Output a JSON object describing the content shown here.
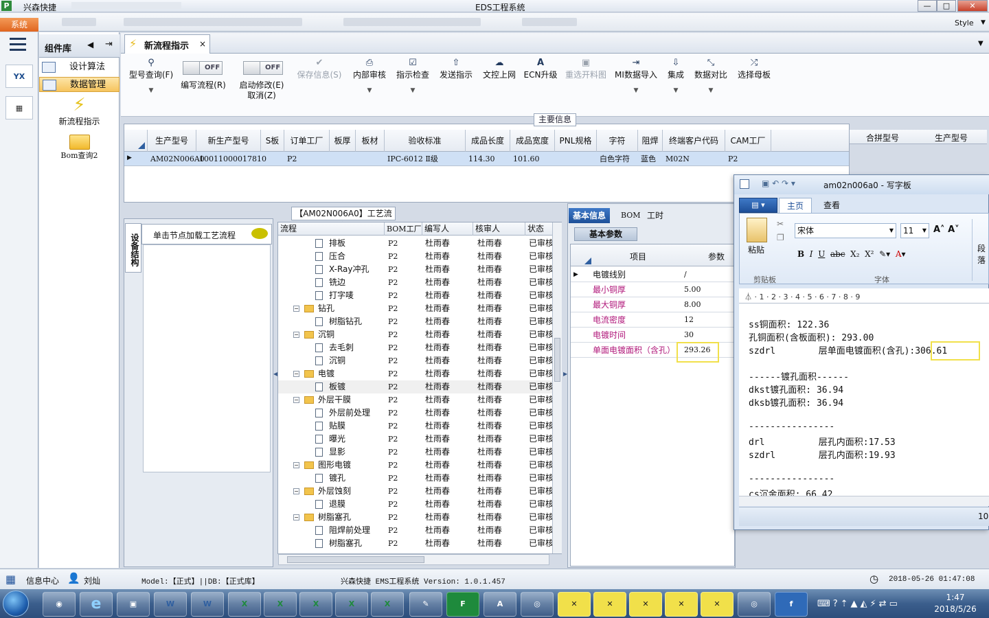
{
  "app": {
    "name": "兴森快捷",
    "window_title": "EDS工程系统",
    "system_menu": "系统",
    "style_label": "Style"
  },
  "left_nav": {
    "menu_icon": "hamburger-icon",
    "icon1": "YX",
    "icon2": "calc"
  },
  "component_panel": {
    "title": "组件库",
    "items": [
      {
        "label": "设计算法"
      },
      {
        "label": "数据管理"
      }
    ],
    "big_items": [
      {
        "label": "新流程指示",
        "icon": "lightning-icon"
      },
      {
        "label": "Bom查询2",
        "icon": "folder-icon"
      }
    ]
  },
  "tab": {
    "label": "新流程指示",
    "close": "×"
  },
  "toolbar": {
    "model_query": "型号查询(F)",
    "edit_flow": "编写流程(R)",
    "start_edit_line1": "启动修改(E)",
    "start_edit_line2": "取消(Z)",
    "toggle_off": "OFF",
    "save_info": "保存信息(S)",
    "internal_review": "内部审核",
    "check_instruction": "指示检查",
    "send_instruction": "发送指示",
    "doc_upload": "文控上网",
    "ecn_upgrade": "ECN升级",
    "reselect": "重选开料图",
    "mi_import": "MI数据导入",
    "integrate": "集成",
    "compare": "数据对比",
    "select_mother": "选择母板"
  },
  "main_info": {
    "group_label": "主要信息",
    "columns": [
      "生产型号",
      "新生产型号",
      "S板",
      "订单工厂",
      "板厚",
      "板材",
      "验收标准",
      "成品长度",
      "成品宽度",
      "PNL规格",
      "字符",
      "阻焊",
      "终端客户代码",
      "CAM工厂"
    ],
    "row": [
      "AM02N006A0",
      "10011000017810",
      "",
      "P2",
      "",
      "",
      "IPC-6012 Ⅱ级",
      "114.30",
      "101.60",
      "",
      "白色字符",
      "蓝色",
      "M02N",
      "P2"
    ],
    "right_columns": [
      "合拼型号",
      "生产型号"
    ]
  },
  "process": {
    "title": "【AM02N006A0】工艺流程",
    "side_tab": "设备结构",
    "click_load": "单击节点加载工艺流程",
    "columns": [
      "流程",
      "BOM工厂",
      "编写人",
      "核审人",
      "状态"
    ],
    "rows": [
      {
        "name": "排板",
        "level": 2,
        "folder": false,
        "bom": "P2",
        "writer": "杜雨春",
        "reviewer": "杜雨春",
        "status": "已审核"
      },
      {
        "name": "压合",
        "level": 2,
        "folder": false,
        "bom": "P2",
        "writer": "杜雨春",
        "reviewer": "杜雨春",
        "status": "已审核"
      },
      {
        "name": "X-Ray冲孔",
        "level": 2,
        "folder": false,
        "bom": "P2",
        "writer": "杜雨春",
        "reviewer": "杜雨春",
        "status": "已审核"
      },
      {
        "name": "铣边",
        "level": 2,
        "folder": false,
        "bom": "P2",
        "writer": "杜雨春",
        "reviewer": "杜雨春",
        "status": "已审核"
      },
      {
        "name": "打字唛",
        "level": 2,
        "folder": false,
        "bom": "P2",
        "writer": "杜雨春",
        "reviewer": "杜雨春",
        "status": "已审核"
      },
      {
        "name": "钻孔",
        "level": 1,
        "folder": true,
        "bom": "P2",
        "writer": "杜雨春",
        "reviewer": "杜雨春",
        "status": "已审核"
      },
      {
        "name": "树脂钻孔",
        "level": 2,
        "folder": false,
        "bom": "P2",
        "writer": "杜雨春",
        "reviewer": "杜雨春",
        "status": "已审核"
      },
      {
        "name": "沉铜",
        "level": 1,
        "folder": true,
        "bom": "P2",
        "writer": "杜雨春",
        "reviewer": "杜雨春",
        "status": "已审核"
      },
      {
        "name": "去毛刺",
        "level": 2,
        "folder": false,
        "bom": "P2",
        "writer": "杜雨春",
        "reviewer": "杜雨春",
        "status": "已审核"
      },
      {
        "name": "沉铜",
        "level": 2,
        "folder": false,
        "bom": "P2",
        "writer": "杜雨春",
        "reviewer": "杜雨春",
        "status": "已审核"
      },
      {
        "name": "电镀",
        "level": 1,
        "folder": true,
        "bom": "P2",
        "writer": "杜雨春",
        "reviewer": "杜雨春",
        "status": "已审核"
      },
      {
        "name": "板镀",
        "level": 2,
        "folder": false,
        "bom": "P2",
        "writer": "杜雨春",
        "reviewer": "杜雨春",
        "status": "已审核",
        "selected": true
      },
      {
        "name": "外层干膜",
        "level": 1,
        "folder": true,
        "bom": "P2",
        "writer": "杜雨春",
        "reviewer": "杜雨春",
        "status": "已审核"
      },
      {
        "name": "外层前处理",
        "level": 2,
        "folder": false,
        "bom": "P2",
        "writer": "杜雨春",
        "reviewer": "杜雨春",
        "status": "已审核"
      },
      {
        "name": "贴膜",
        "level": 2,
        "folder": false,
        "bom": "P2",
        "writer": "杜雨春",
        "reviewer": "杜雨春",
        "status": "已审核"
      },
      {
        "name": "曝光",
        "level": 2,
        "folder": false,
        "bom": "P2",
        "writer": "杜雨春",
        "reviewer": "杜雨春",
        "status": "已审核"
      },
      {
        "name": "显影",
        "level": 2,
        "folder": false,
        "bom": "P2",
        "writer": "杜雨春",
        "reviewer": "杜雨春",
        "status": "已审核"
      },
      {
        "name": "图形电镀",
        "level": 1,
        "folder": true,
        "bom": "P2",
        "writer": "杜雨春",
        "reviewer": "杜雨春",
        "status": "已审核"
      },
      {
        "name": "镀孔",
        "level": 2,
        "folder": false,
        "bom": "P2",
        "writer": "杜雨春",
        "reviewer": "杜雨春",
        "status": "已审核"
      },
      {
        "name": "外层蚀刻",
        "level": 1,
        "folder": true,
        "bom": "P2",
        "writer": "杜雨春",
        "reviewer": "杜雨春",
        "status": "已审核"
      },
      {
        "name": "退膜",
        "level": 2,
        "folder": false,
        "bom": "P2",
        "writer": "杜雨春",
        "reviewer": "杜雨春",
        "status": "已审核"
      },
      {
        "name": "树脂塞孔",
        "level": 1,
        "folder": true,
        "bom": "P2",
        "writer": "杜雨春",
        "reviewer": "杜雨春",
        "status": "已审核"
      },
      {
        "name": "阻焊前处理",
        "level": 2,
        "folder": false,
        "bom": "P2",
        "writer": "杜雨春",
        "reviewer": "杜雨春",
        "status": "已审核"
      },
      {
        "name": "树脂塞孔",
        "level": 2,
        "folder": false,
        "bom": "P2",
        "writer": "杜雨春",
        "reviewer": "杜雨春",
        "status": "已审核"
      }
    ]
  },
  "basic_info": {
    "tabs": [
      "基本信息",
      "BOM",
      "工时"
    ],
    "param_header": "基本参数",
    "columns": [
      "项目",
      "参数"
    ],
    "rows": [
      {
        "name": "电镀线别",
        "value": "/"
      },
      {
        "name": "最小铜厚",
        "value": "5.00"
      },
      {
        "name": "最大铜厚",
        "value": "8.00"
      },
      {
        "name": "电流密度",
        "value": "12"
      },
      {
        "name": "电镀时间",
        "value": "30"
      },
      {
        "name": "单面电镀面积（含孔）",
        "value": "293.26"
      }
    ]
  },
  "wordpad": {
    "title": "am02n006a0 - 写字板",
    "tabs": [
      "主页",
      "查看"
    ],
    "paste": "粘贴",
    "clipboard": "剪贴板",
    "font_name": "宋体",
    "font_size": "11",
    "font_group": "字体",
    "para_group": "段落",
    "lines": [
      "ss铜面积: 122.36",
      "孔铜面积(含板面积): 293.00",
      "szdrl        层单面电镀面积(含孔):306.61",
      "",
      "------镀孔面积------",
      "dkst镀孔面积: 36.94",
      "dksb镀孔面积: 36.94",
      "",
      "----------------",
      "drl          层孔内面积:17.53",
      "szdrl        层孔内面积:19.93",
      "",
      "----------------",
      "cs沉金面积: 66.42"
    ],
    "zoom": "10"
  },
  "status_bar": {
    "info_center": "信息中心",
    "user": "刘灿",
    "model_db": "Model:【正式】||DB:【正式库】",
    "system_version": "兴森快捷 EMS工程系统 Version: 1.0.1.457",
    "datetime": "2018-05-26 01:47:08"
  },
  "taskbar": {
    "time": "1:47",
    "date": "2018/5/26"
  }
}
